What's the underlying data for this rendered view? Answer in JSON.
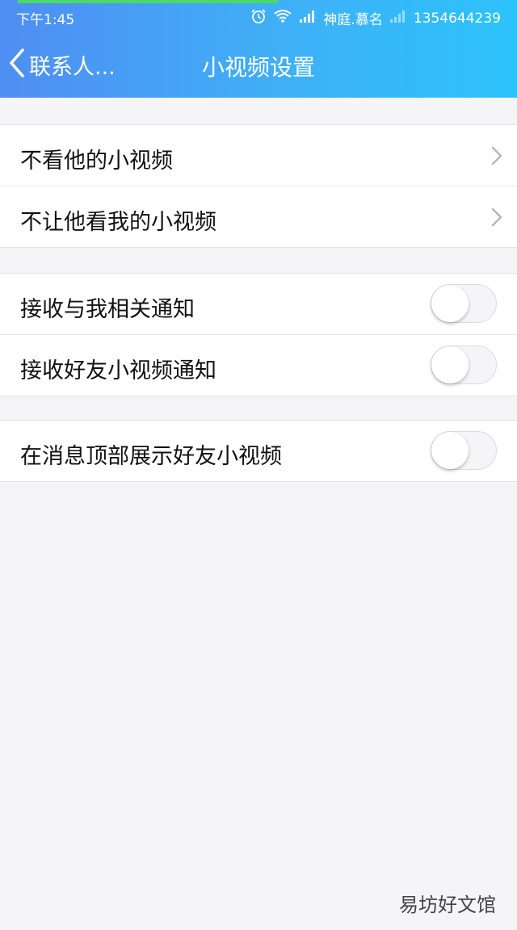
{
  "status_bar": {
    "time": "下午1:45",
    "carrier": "神庭.慕名",
    "phone_number": "1354644239",
    "icons": [
      "alarm-icon",
      "wifi-icon",
      "signal-icon",
      "signal-icon"
    ]
  },
  "nav": {
    "back_label": "联系人...",
    "title": "小视频设置"
  },
  "sections": [
    {
      "items": [
        {
          "label": "不看他的小视频",
          "control": "chevron"
        },
        {
          "label": "不让他看我的小视频",
          "control": "chevron"
        }
      ]
    },
    {
      "items": [
        {
          "label": "接收与我相关通知",
          "control": "toggle",
          "on": false
        },
        {
          "label": "接收好友小视频通知",
          "control": "toggle",
          "on": false
        }
      ]
    },
    {
      "items": [
        {
          "label": "在消息顶部展示好友小视频",
          "control": "toggle",
          "on": false
        }
      ]
    }
  ],
  "watermark": "易坊好文馆",
  "colors": {
    "header_gradient_start": "#4f8ef2",
    "header_gradient_end": "#2cc3fb",
    "background": "#f5f5f7",
    "accent_bar": "#4cd964"
  }
}
